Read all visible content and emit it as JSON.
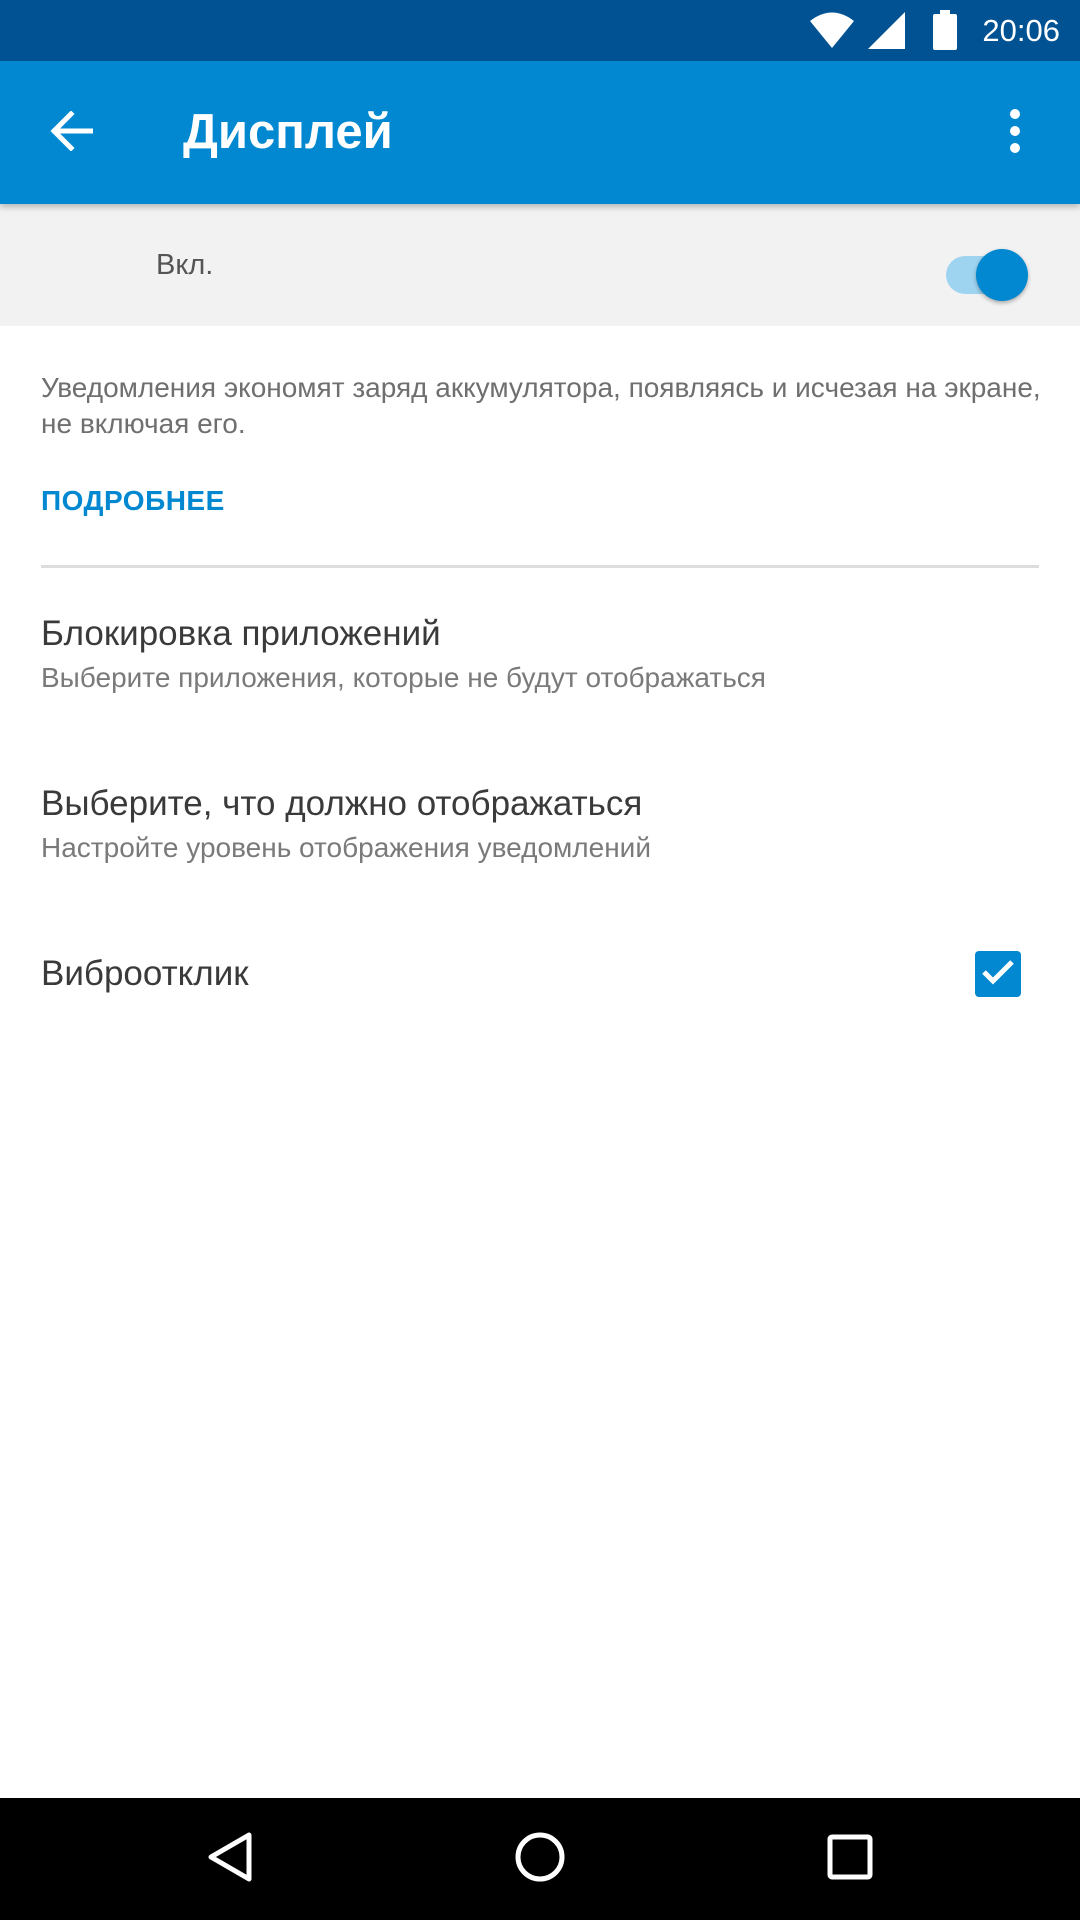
{
  "status_bar": {
    "time": "20:06",
    "icons": [
      "wifi-icon",
      "cell-signal-icon",
      "battery-icon"
    ]
  },
  "app_bar": {
    "title": "Дисплей",
    "back_icon": "arrow-back-icon",
    "menu_icon": "more-vert-icon"
  },
  "master_switch": {
    "label": "Вкл.",
    "on": true
  },
  "description": {
    "text": "Уведомления экономят заряд аккумулятора, появляясь и исчезая на экране, не включая его.",
    "link": "ПОДРОБНЕЕ"
  },
  "preferences": [
    {
      "title": "Блокировка приложений",
      "summary": "Выберите приложения, которые не будут отображаться"
    },
    {
      "title": "Выберите, что должно отображаться",
      "summary": "Настройте уровень отображения уведомлений"
    },
    {
      "title": "Виброотклик",
      "checked": true
    }
  ],
  "nav_bar": {
    "icons": [
      "back-triangle-icon",
      "home-circle-icon",
      "recents-square-icon"
    ]
  },
  "colors": {
    "accent": "#0288d1",
    "status_bar": "#005293",
    "toggle_track": "#9fd4f0"
  }
}
